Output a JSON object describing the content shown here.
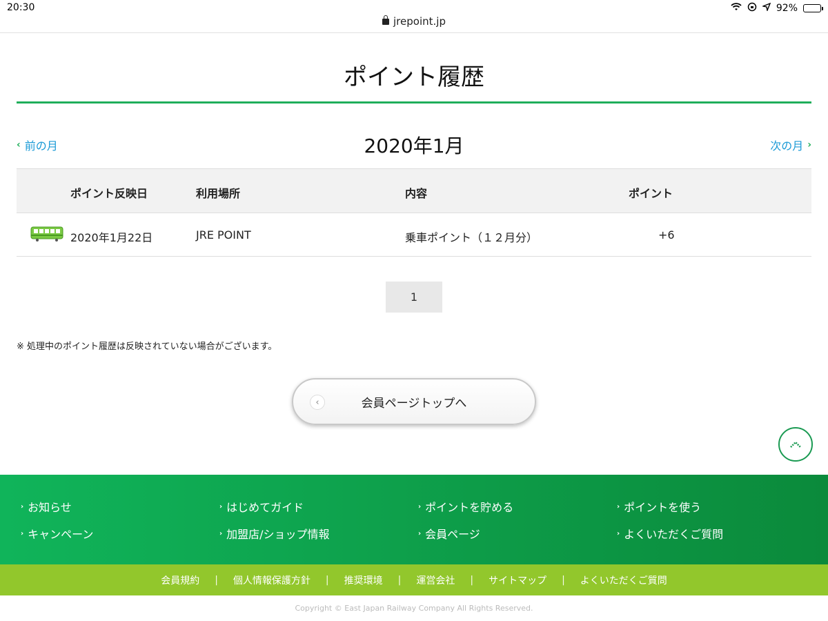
{
  "status": {
    "time": "20:30",
    "battery": "92%",
    "battery_level": 0.92
  },
  "browser": {
    "url": "jrepoint.jp"
  },
  "page": {
    "title": "ポイント履歴"
  },
  "month_nav": {
    "prev_label": "前の月",
    "current": "2020年1月",
    "next_label": "次の月"
  },
  "table": {
    "headers": {
      "date": "ポイント反映日",
      "place": "利用場所",
      "content": "内容",
      "point": "ポイント"
    },
    "rows": [
      {
        "icon": "train-icon",
        "date": "2020年1月22日",
        "place": "JRE POINT",
        "content": "乗車ポイント（１２月分）",
        "point": "+6"
      }
    ]
  },
  "pagination": {
    "current_page": "1"
  },
  "note": "※ 処理中のポイント履歴は反映されていない場合がございます。",
  "back_button": {
    "label": "会員ページトップへ"
  },
  "footer": {
    "nav": [
      "お知らせ",
      "はじめてガイド",
      "ポイントを貯める",
      "ポイントを使う",
      "キャンペーン",
      "加盟店/ショップ情報",
      "会員ページ",
      "よくいただくご質問"
    ],
    "links": [
      "会員規約",
      "個人情報保護方針",
      "推奨環境",
      "運営会社",
      "サイトマップ",
      "よくいただくご質問"
    ],
    "copyright": "Copyright © East Japan Railway Company All Rights Reserved."
  },
  "colors": {
    "brand_green": "#1fae5a",
    "link_blue": "#1a9ad6",
    "footer_lime": "#92c72c"
  }
}
